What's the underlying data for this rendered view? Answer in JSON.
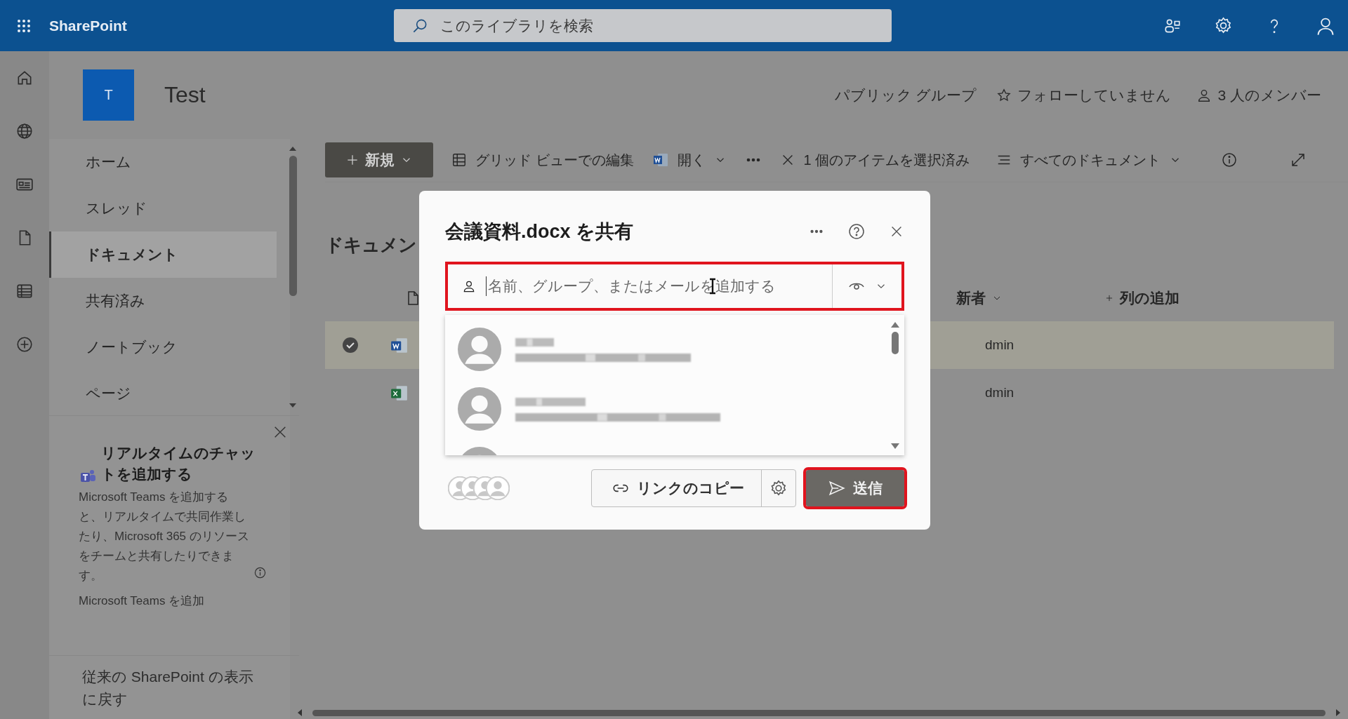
{
  "app": {
    "name": "SharePoint"
  },
  "search": {
    "placeholder": "このライブラリを検索"
  },
  "site": {
    "logo_letter": "T",
    "title": "Test",
    "privacy": "パブリック グループ",
    "follow": "フォローしていません",
    "members": "3 人のメンバー"
  },
  "nav": {
    "items": [
      {
        "label": "ホーム",
        "selected": false
      },
      {
        "label": "スレッド",
        "selected": false
      },
      {
        "label": "ドキュメント",
        "selected": true
      },
      {
        "label": "共有済み",
        "selected": false
      },
      {
        "label": "ノートブック",
        "selected": false
      },
      {
        "label": "ページ",
        "selected": false
      }
    ]
  },
  "promo": {
    "title": "リアルタイムのチャットを追加する",
    "body": "Microsoft Teams を追加すると、リアルタイムで共同作業したり、Microsoft 365 のリソースをチームと共有したりできます。",
    "link": "Microsoft Teams を追加"
  },
  "classic_link": "従来の SharePoint の表示に戻す",
  "commands": [
    {
      "kind": "new",
      "label": "新規"
    },
    {
      "kind": "grid",
      "label": "グリッド ビューでの編集"
    },
    {
      "kind": "open",
      "label": "開く"
    },
    {
      "kind": "more"
    },
    {
      "kind": "selection",
      "label": "1 個のアイテムを選択済み"
    },
    {
      "kind": "view",
      "label": "すべてのドキュメント"
    },
    {
      "kind": "info"
    },
    {
      "kind": "expand"
    }
  ],
  "library": {
    "title": "ドキュメン",
    "columns": [
      {
        "kind": "icon"
      },
      {
        "kind": "sort",
        "label": "新者"
      },
      {
        "kind": "add",
        "label": "列の追加"
      }
    ],
    "rows": [
      {
        "kind": "word",
        "selected": true,
        "modified_by": "dmin"
      },
      {
        "kind": "excel",
        "selected": false,
        "modified_by": "dmin"
      }
    ]
  },
  "dialog": {
    "title": "会議資料.docx を共有",
    "field": {
      "placeholder": "名前、グループ、またはメールを追加する",
      "highlighted": true
    },
    "suggestions": [
      {
        "kind": "person"
      },
      {
        "kind": "person"
      },
      {
        "kind": "person"
      }
    ],
    "copy_link": "リンクのコピー",
    "send": {
      "label": "送信",
      "highlighted": true
    }
  }
}
